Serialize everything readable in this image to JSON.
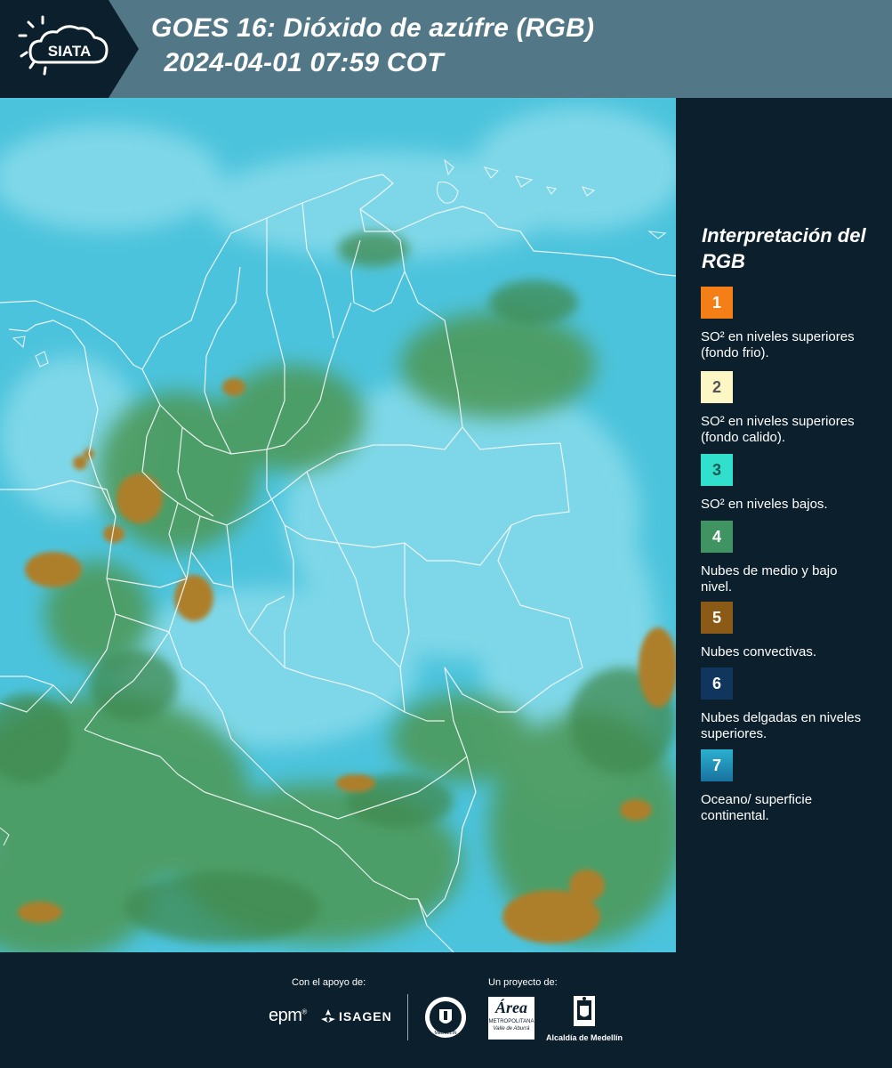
{
  "header": {
    "logo_text": "SIATA",
    "title_line1": "GOES 16: Dióxido de azúfre (RGB)",
    "title_line2": " 2024-04-01 07:59 COT"
  },
  "legend": {
    "title": "Interpretación del RGB",
    "items": [
      {
        "number": "1",
        "label": "SO² en niveles superiores (fondo frio).",
        "color": "#f47f16",
        "number_color": "#ffffff"
      },
      {
        "number": "2",
        "label": "SO² en niveles superiores (fondo calido).",
        "color": "#fdf6c5",
        "number_color": "#555555"
      },
      {
        "number": "3",
        "label": "SO² en niveles bajos.",
        "color": "#30e0cc",
        "number_color": "#1b5b55"
      },
      {
        "number": "4",
        "label": "Nubes de medio y bajo nivel.",
        "color": "#3f9462",
        "number_color": "#ffffff"
      },
      {
        "number": "5",
        "label": "Nubes convectivas.",
        "color": "#8b5a16",
        "number_color": "#ffffff"
      },
      {
        "number": "6",
        "label": "Nubes delgadas en niveles superiores.",
        "color": "#10365e",
        "number_color": "#ffffff"
      },
      {
        "number": "7",
        "label": "Oceano/ superficie continental.",
        "color": "#1f8fb5",
        "number_color": "#ffffff"
      }
    ]
  },
  "footer": {
    "support_label": "Con el apoyo de:",
    "project_label": "Un proyecto de:",
    "sponsors": {
      "epm": "epm",
      "isagen": "ISAGEN",
      "area": "Área",
      "area_sub1": "METROPOLITANA",
      "area_sub2": "Valle de Aburrá",
      "alcaldia": "Alcaldía de Medellín",
      "seal_text": "MEDELLÍN"
    }
  },
  "map": {
    "description_colors": {
      "background": "#4dc4dc",
      "green": "#4e9a5a",
      "brown": "#a9802f",
      "border": "#f2f6f7"
    }
  }
}
